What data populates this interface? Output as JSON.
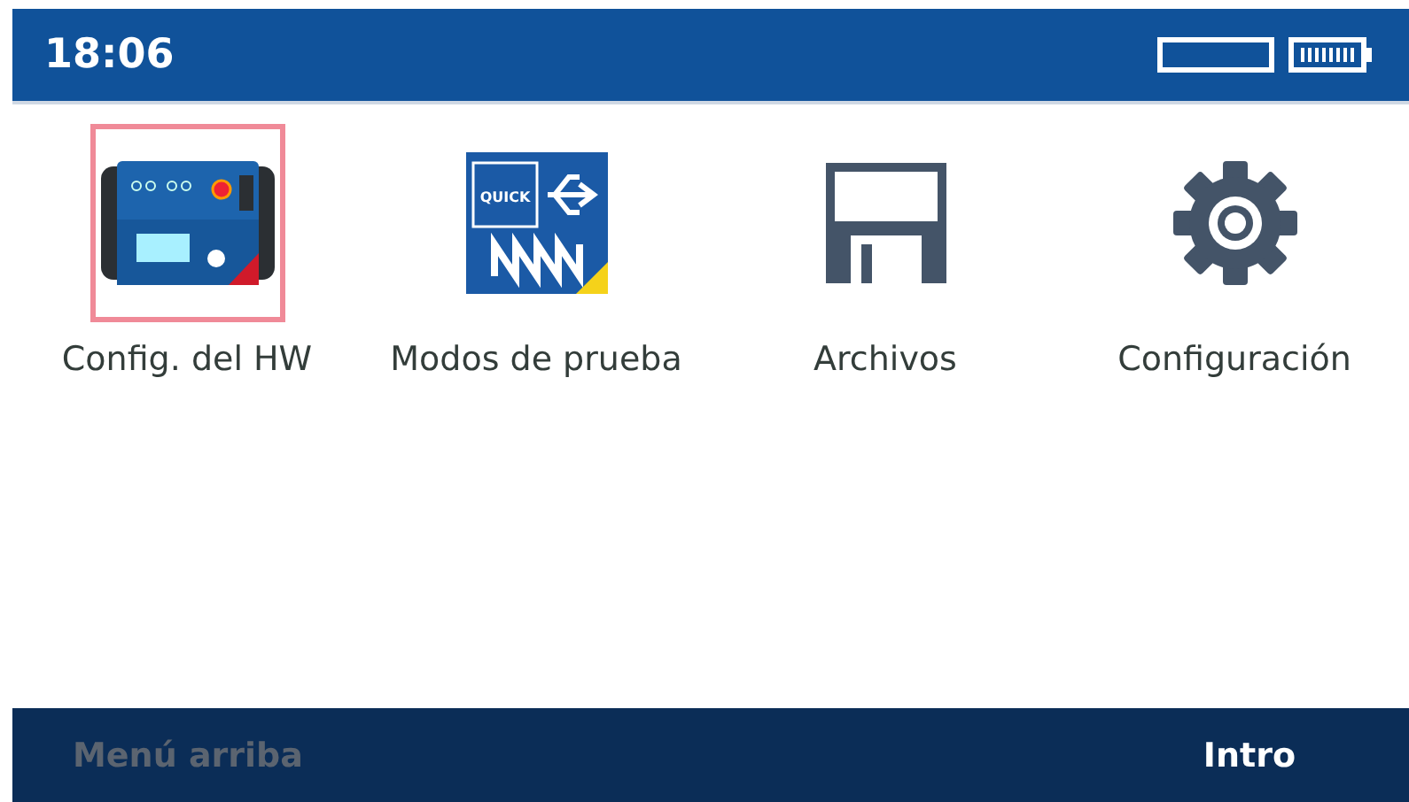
{
  "status_bar": {
    "time": "18:06"
  },
  "menu_items": [
    {
      "kind": "device",
      "label": "Config. del HW",
      "selected": true
    },
    {
      "kind": "quick",
      "label": "Modos de prueba",
      "selected": false,
      "badge": "QUICK"
    },
    {
      "kind": "floppy",
      "label": "Archivos",
      "selected": false
    },
    {
      "kind": "gear",
      "label": "Configuración",
      "selected": false
    }
  ],
  "soft_keys": [
    {
      "label": "Menú arriba",
      "disabled": true
    },
    {
      "label": "Intro",
      "disabled": false
    }
  ]
}
